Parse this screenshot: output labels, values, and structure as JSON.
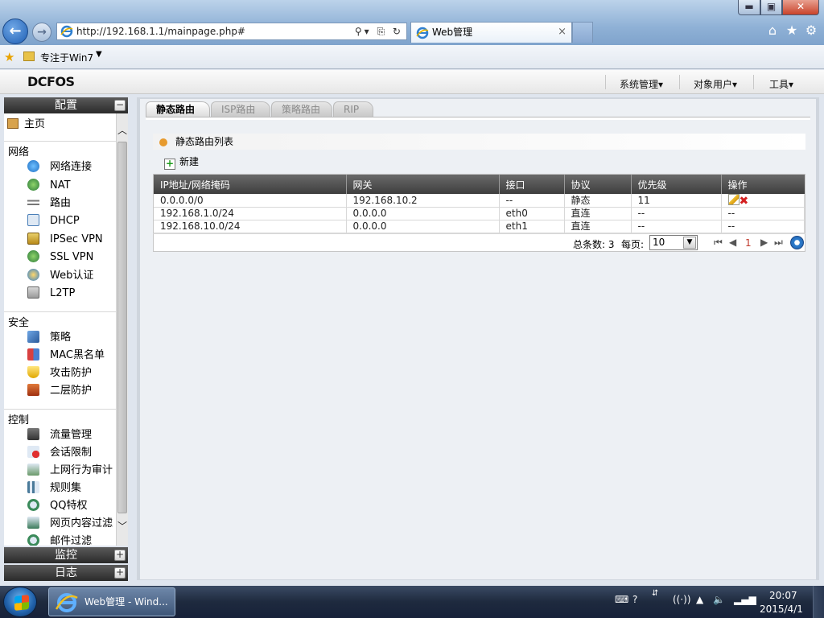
{
  "browser": {
    "url": "http://192.168.1.1/mainpage.php#",
    "tab_title": "Web管理",
    "tab_close": "×",
    "favorites_label": "专注于Win7",
    "window_min": "▬",
    "window_max": "▣",
    "window_close": "✕"
  },
  "app": {
    "logo": "DCFOS",
    "menu": [
      "系统管理▾",
      "对象用户▾",
      "工具▾"
    ]
  },
  "sidebar": {
    "config_label": "配置",
    "collapse_symbol": "−",
    "expand_symbol": "+",
    "home": "主页",
    "groups": [
      {
        "label": "网络",
        "items": [
          "网络连接",
          "NAT",
          "路由",
          "DHCP",
          "IPSec VPN",
          "SSL VPN",
          "Web认证",
          "L2TP"
        ]
      },
      {
        "label": "安全",
        "items": [
          "策略",
          "MAC黑名单",
          "攻击防护",
          "二层防护"
        ]
      },
      {
        "label": "控制",
        "items": [
          "流量管理",
          "会话限制",
          "上网行为审计",
          "规则集",
          "QQ特权",
          "网页内容过滤",
          "邮件过滤"
        ]
      }
    ],
    "monitor_label": "监控",
    "log_label": "日志"
  },
  "main": {
    "tabs": [
      "静态路由",
      "ISP路由",
      "策略路由",
      "RIP"
    ],
    "active_tab": "静态路由",
    "list_title": "静态路由列表",
    "new_button": "新建",
    "columns": [
      "IP地址/网络掩码",
      "网关",
      "接口",
      "协议",
      "优先级",
      "操作"
    ],
    "rows": [
      [
        "0.0.0.0/0",
        "192.168.10.2",
        "--",
        "静态",
        "11",
        ""
      ],
      [
        "192.168.1.0/24",
        "0.0.0.0",
        "eth0",
        "直连",
        "--",
        "--"
      ],
      [
        "192.168.10.0/24",
        "0.0.0.0",
        "eth1",
        "直连",
        "--",
        "--"
      ]
    ],
    "pager": {
      "total": "总条数: 3",
      "per_page_label": "每页:",
      "per_page_value": "10",
      "current_page": "1"
    }
  },
  "taskbar": {
    "task_label": "Web管理 - Wind...",
    "time": "20:07",
    "date": "2015/4/1"
  }
}
